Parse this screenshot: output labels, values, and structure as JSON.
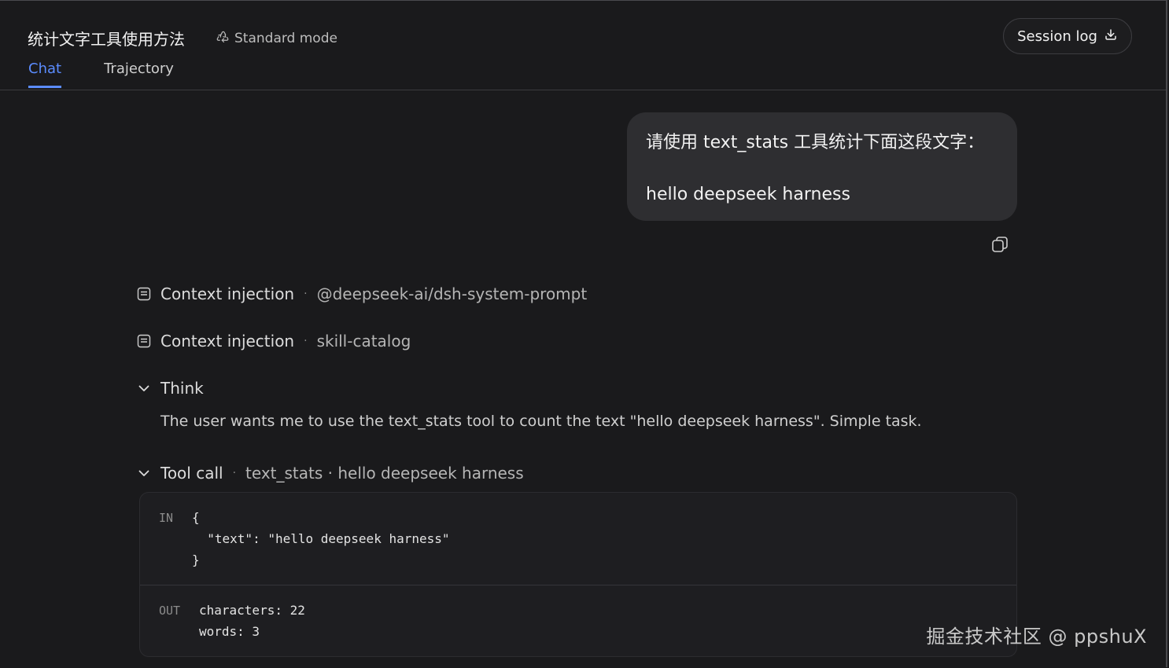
{
  "header": {
    "title": "统计文字工具使用方法",
    "mode_label": "Standard mode",
    "mode_icon": "recycle-icon",
    "session_button": "Session log",
    "session_icon": "download-icon"
  },
  "tabs": [
    {
      "label": "Chat",
      "active": true
    },
    {
      "label": "Trajectory",
      "active": false
    }
  ],
  "user_message": {
    "line1": "请使用 text_stats 工具统计下面这段文字：",
    "line2": "hello deepseek harness"
  },
  "timeline": {
    "context1": {
      "label": "Context injection",
      "detail": "@deepseek-ai/dsh-system-prompt"
    },
    "context2": {
      "label": "Context injection",
      "detail": "skill-catalog"
    },
    "think": {
      "label": "Think",
      "text": "The user wants me to use the text_stats tool to count the text \"hello deepseek harness\". Simple task."
    },
    "tool_call": {
      "label": "Tool call",
      "detail": "text_stats · hello deepseek harness",
      "in_tag": "IN",
      "in_lines": [
        "{",
        "  \"text\": \"hello deepseek harness\"",
        "}"
      ],
      "out_tag": "OUT",
      "out_lines": [
        "characters: 22",
        "words: 3"
      ]
    }
  },
  "watermark": "掘金技术社区 @ ppshuX",
  "colors": {
    "background": "#1a1a1c",
    "accent": "#5b8cff",
    "bubble": "#2e2e31"
  }
}
